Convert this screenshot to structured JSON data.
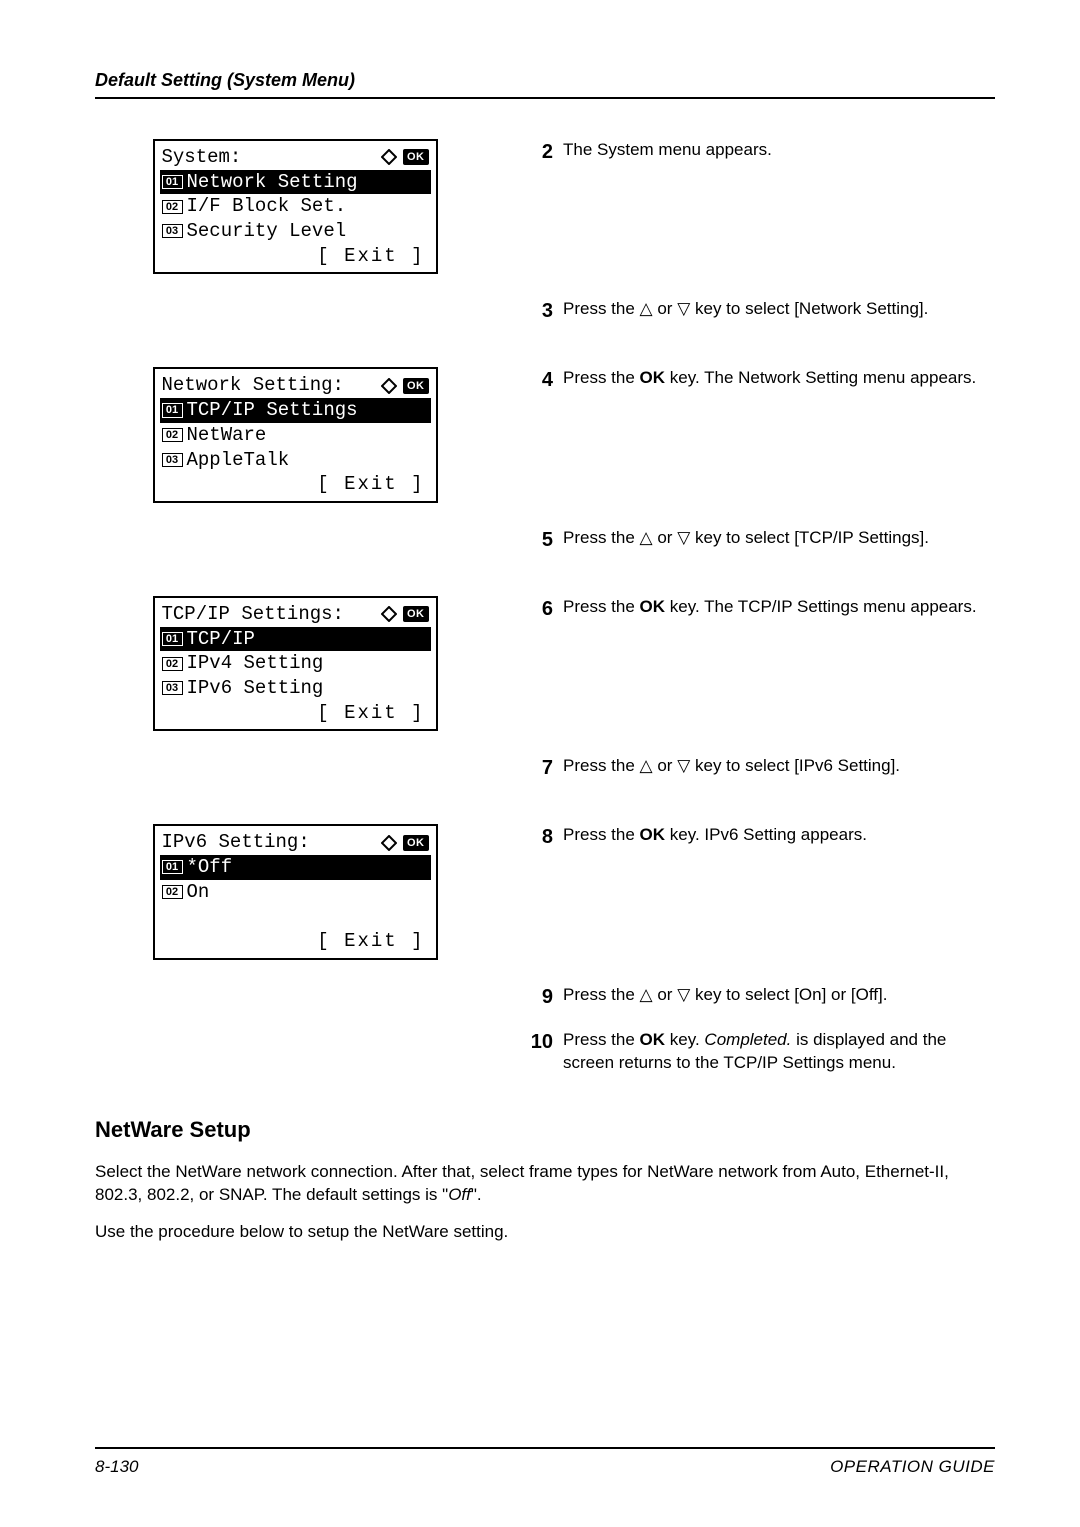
{
  "header": "Default Setting (System Menu)",
  "lcd": {
    "system": {
      "title": "System:",
      "items": [
        {
          "n": "01",
          "label": "Network Setting",
          "selected": true
        },
        {
          "n": "02",
          "label": "I/F Block Set.",
          "selected": false
        },
        {
          "n": "03",
          "label": "Security Level",
          "selected": false
        }
      ],
      "soft": "[  Exit  ]"
    },
    "net": {
      "title": "Network Setting:",
      "items": [
        {
          "n": "01",
          "label": "TCP/IP Settings",
          "selected": true
        },
        {
          "n": "02",
          "label": "NetWare",
          "selected": false
        },
        {
          "n": "03",
          "label": "AppleTalk",
          "selected": false
        }
      ],
      "soft": "[  Exit  ]"
    },
    "tcp": {
      "title": "TCP/IP Settings:",
      "items": [
        {
          "n": "01",
          "label": "TCP/IP",
          "selected": true
        },
        {
          "n": "02",
          "label": "IPv4 Setting",
          "selected": false
        },
        {
          "n": "03",
          "label": "IPv6 Setting",
          "selected": false
        }
      ],
      "soft": "[  Exit  ]"
    },
    "ipv6": {
      "title": "IPv6 Setting:",
      "items": [
        {
          "n": "01",
          "label": "*Off",
          "selected": true
        },
        {
          "n": "02",
          "label": "On",
          "selected": false
        }
      ],
      "soft": "[  Exit  ]"
    }
  },
  "steps": {
    "s2": "The System menu appears.",
    "s3a": "Press the ",
    "s3b": " or ",
    "s3c": " key to select [Network Setting].",
    "s4a": "Press the ",
    "s4ok": "OK",
    "s4b": " key. The Network Setting menu appears.",
    "s5a": "Press the ",
    "s5b": " or ",
    "s5c": " key to select [TCP/IP Settings].",
    "s6a": "Press the ",
    "s6ok": "OK",
    "s6b": " key. The TCP/IP Settings menu appears.",
    "s7a": "Press the ",
    "s7b": " or ",
    "s7c": " key to select [IPv6 Setting].",
    "s8a": "Press the ",
    "s8ok": "OK",
    "s8b": " key. IPv6 Setting appears.",
    "s9a": "Press the ",
    "s9b": " or ",
    "s9c": " key to select [On] or [Off].",
    "s10a": "Press the ",
    "s10ok": "OK",
    "s10b": " key. ",
    "s10c": "Completed.",
    "s10d": " is displayed and the screen returns to the TCP/IP Settings menu."
  },
  "netware": {
    "heading": "NetWare Setup",
    "p1": "Select the NetWare network connection. After that, select frame types for NetWare network from Auto, Ethernet-II, 802.3, 802.2, or SNAP. The default settings is \"",
    "p1i": "Off",
    "p1end": "\".",
    "p2": "Use the procedure below to setup the NetWare setting."
  },
  "footer": {
    "page": "8-130",
    "guide": "OPERATION GUIDE"
  },
  "ok_label": "OK"
}
